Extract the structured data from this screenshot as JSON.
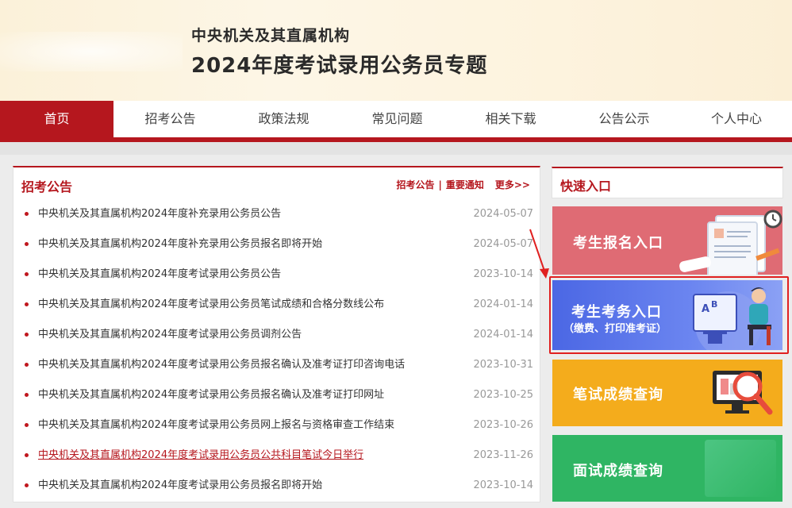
{
  "header": {
    "subtitle": "中央机关及其直属机构",
    "title": "2024年度考试录用公务员专题"
  },
  "nav": {
    "items": [
      "首页",
      "招考公告",
      "政策法规",
      "常见问题",
      "相关下载",
      "公告公示",
      "个人中心"
    ],
    "active_index": 0
  },
  "announcements": {
    "title": "招考公告",
    "link_notice": "招考公告",
    "separator": "|",
    "link_important": "重要通知",
    "more": "更多>>",
    "items": [
      {
        "title": "中央机关及其直属机构2024年度补充录用公务员公告",
        "date": "2024-05-07"
      },
      {
        "title": "中央机关及其直属机构2024年度补充录用公务员报名即将开始",
        "date": "2024-05-07"
      },
      {
        "title": "中央机关及其直属机构2024年度考试录用公务员公告",
        "date": "2023-10-14"
      },
      {
        "title": "中央机关及其直属机构2024年度考试录用公务员笔试成绩和合格分数线公布",
        "date": "2024-01-14"
      },
      {
        "title": "中央机关及其直属机构2024年度考试录用公务员调剂公告",
        "date": "2024-01-14"
      },
      {
        "title": "中央机关及其直属机构2024年度考试录用公务员报名确认及准考证打印咨询电话",
        "date": "2023-10-31"
      },
      {
        "title": "中央机关及其直属机构2024年度考试录用公务员报名确认及准考证打印网址",
        "date": "2023-10-25"
      },
      {
        "title": "中央机关及其直属机构2024年度考试录用公务员网上报名与资格审查工作结束",
        "date": "2023-10-26"
      },
      {
        "title": "中央机关及其直属机构2024年度考试录用公务员公共科目笔试今日举行",
        "date": "2023-11-26",
        "highlighted": true
      },
      {
        "title": "中央机关及其直属机构2024年度考试录用公务员报名即将开始",
        "date": "2023-10-14"
      }
    ]
  },
  "quick_entry": {
    "title": "快速入口",
    "registration": "考生报名入口",
    "affairs": "考生考务入口",
    "affairs_sub": "（缴费、打印准考证）",
    "written_score": "笔试成绩查询",
    "interview_score": "面试成绩查询"
  },
  "colors": {
    "brand_red": "#b5171e",
    "registration_card": "#df6b74",
    "affairs_card": "#4b67e4",
    "written_card": "#f4ac1c",
    "interview_card": "#2fb563"
  }
}
